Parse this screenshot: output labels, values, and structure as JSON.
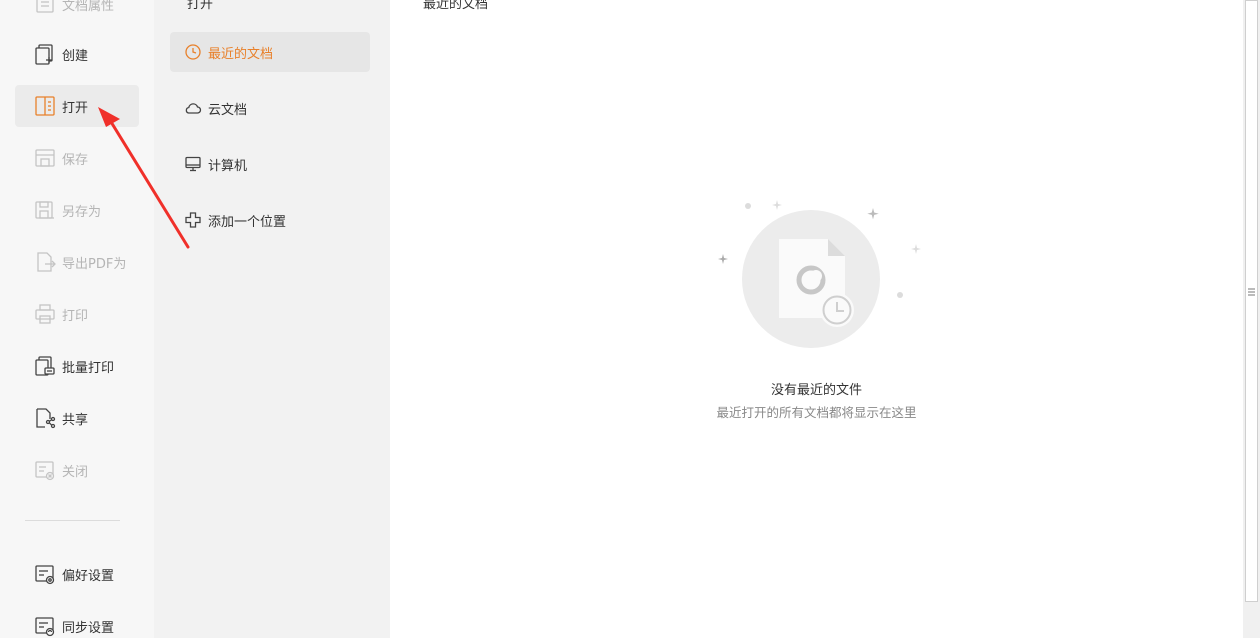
{
  "sidebar": {
    "items": [
      {
        "label": "文档属性",
        "icon": "document-properties-icon",
        "state": "disabled"
      },
      {
        "label": "创建",
        "icon": "create-icon",
        "state": "normal"
      },
      {
        "label": "打开",
        "icon": "open-icon",
        "state": "active"
      },
      {
        "label": "保存",
        "icon": "save-icon",
        "state": "disabled"
      },
      {
        "label": "另存为",
        "icon": "save-as-icon",
        "state": "disabled"
      },
      {
        "label": "导出PDF为",
        "icon": "export-pdf-icon",
        "state": "disabled"
      },
      {
        "label": "打印",
        "icon": "print-icon",
        "state": "disabled"
      },
      {
        "label": "批量打印",
        "icon": "batch-print-icon",
        "state": "normal"
      },
      {
        "label": "共享",
        "icon": "share-icon",
        "state": "normal"
      },
      {
        "label": "关闭",
        "icon": "close-doc-icon",
        "state": "disabled"
      }
    ],
    "bottom_items": [
      {
        "label": "偏好设置",
        "icon": "preferences-icon"
      },
      {
        "label": "同步设置",
        "icon": "sync-settings-icon"
      }
    ]
  },
  "midpanel": {
    "heading": "打开",
    "items": [
      {
        "label": "最近的文档",
        "icon": "clock-icon",
        "active": true
      },
      {
        "label": "云文档",
        "icon": "cloud-icon",
        "active": false
      },
      {
        "label": "计算机",
        "icon": "monitor-icon",
        "active": false
      },
      {
        "label": "添加一个位置",
        "icon": "add-location-icon",
        "active": false
      }
    ]
  },
  "main": {
    "heading": "最近的文档",
    "empty_title": "没有最近的文件",
    "empty_subtitle": "最近打开的所有文档都将显示在这里"
  },
  "colors": {
    "accent": "#e8802a",
    "annotation_arrow": "#f0302a",
    "disabled_text": "#b5b5b5"
  }
}
